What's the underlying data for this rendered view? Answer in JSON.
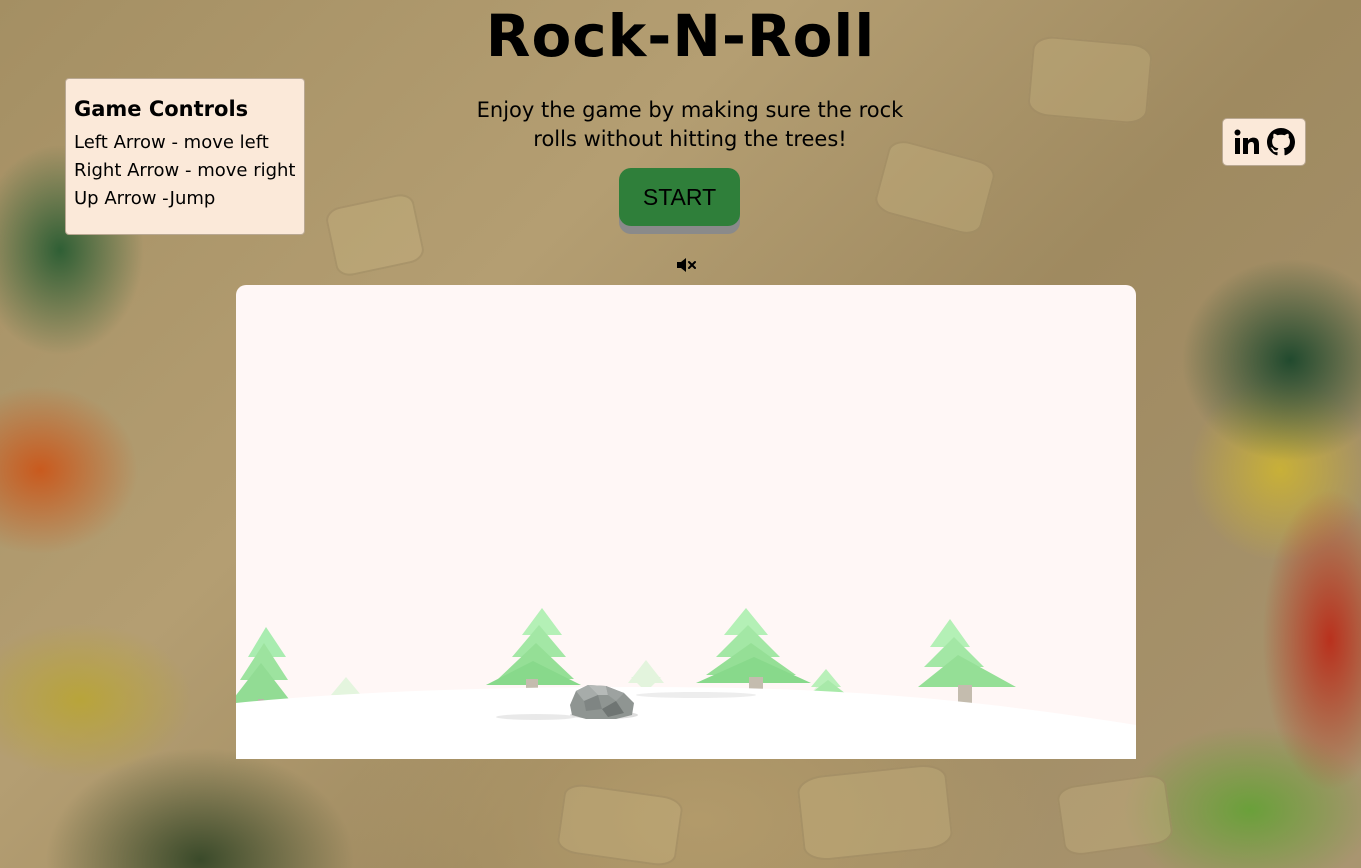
{
  "header": {
    "title": "Rock-N-Roll",
    "subtitle": "Enjoy the game by making sure the rock rolls without hitting the trees!"
  },
  "start_button": {
    "label": "START",
    "color": "#2f7f3a"
  },
  "sound_toggle": {
    "icon": "volume-mute-icon",
    "state": "muted"
  },
  "controls_panel": {
    "heading": "Game Controls",
    "lines": [
      "Left Arrow - move left",
      "Right Arrow - move right",
      "Up Arrow -Jump"
    ]
  },
  "social_links": [
    {
      "icon": "linkedin-icon"
    },
    {
      "icon": "github-icon"
    }
  ],
  "game_scene": {
    "background_color": "#fff7f6",
    "ground_color": "#ffffff",
    "tree_color": "#9ee89a",
    "rock_color": "#8f9592"
  }
}
